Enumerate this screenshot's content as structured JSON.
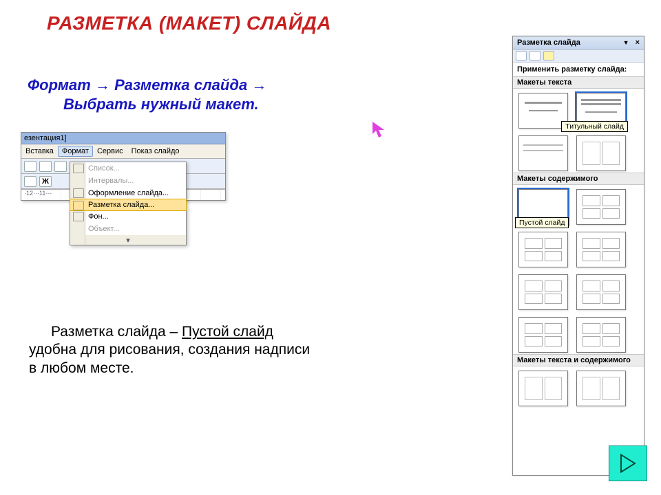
{
  "title": "РАЗМЕТКА (МАКЕТ) СЛАЙДА",
  "path": {
    "line1_a": "Формат ",
    "arrow": "→",
    "line1_b": " Разметка слайда ",
    "line2": "Выбрать нужный макет."
  },
  "body": {
    "lead": "Разметка слайда – ",
    "ul": "Пустой слайд",
    "rest1": "удобна для рисования, создания надписи",
    "rest2": "в любом месте."
  },
  "menu": {
    "titlebar": "езентация1]",
    "menubar": [
      "Вставка",
      "Формат",
      "Сервис",
      "Показ слайдо"
    ],
    "toolbar_btn": "Ж",
    "ruler": "·12···11···",
    "items": [
      {
        "label": "Список...",
        "disabled": true
      },
      {
        "label": "Интервалы...",
        "disabled": true
      },
      {
        "label": "Оформление слайда...",
        "disabled": false
      },
      {
        "label": "Разметка слайда...",
        "disabled": false,
        "selected": true
      },
      {
        "label": "Фон...",
        "disabled": false
      },
      {
        "label": "Объект...",
        "disabled": true
      }
    ],
    "more": "▾"
  },
  "pane": {
    "title": "Разметка слайда",
    "dropdown_glyph": "▼",
    "close_glyph": "×",
    "apply_label": "Применить разметку слайда:",
    "groups": {
      "text": "Макеты текста",
      "content": "Макеты содержимого",
      "text_content": "Макеты текста и содержимого"
    },
    "tooltips": {
      "title_slide": "Титульный слайд",
      "empty_slide": "Пустой слайд"
    }
  },
  "icons": {
    "cursor": "➤"
  }
}
